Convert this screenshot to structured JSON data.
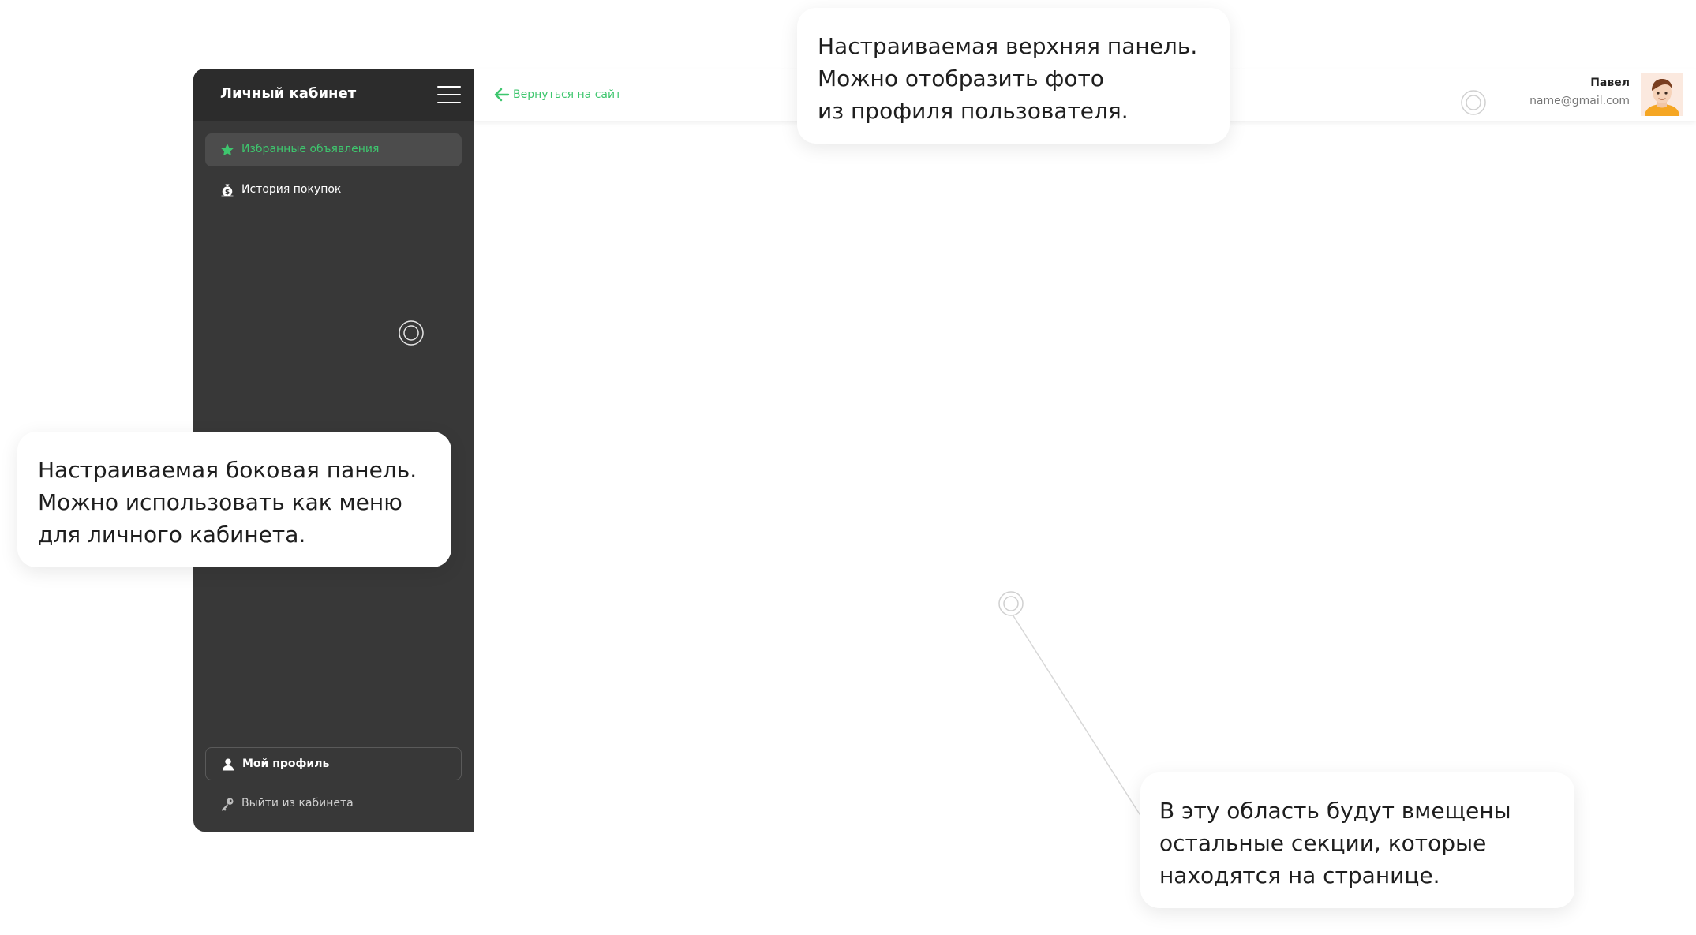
{
  "sidebar": {
    "title": "Личный кабинет",
    "items": [
      {
        "label": "Избранные объявления",
        "icon": "star-icon",
        "active": true
      },
      {
        "label": "История покупок",
        "icon": "money-bag-icon",
        "active": false
      }
    ],
    "bottom_items": [
      {
        "label": "Мой профиль",
        "icon": "user-icon"
      },
      {
        "label": "Выйти из кабинета",
        "icon": "key-icon"
      }
    ]
  },
  "topbar": {
    "back_label": "Вернуться на сайт",
    "user_name": "Павел",
    "user_email": "name@gmail.com"
  },
  "callouts": {
    "top": [
      "Настраиваемая верхняя панель.",
      "Можно отобразить фото",
      "из профиля пользователя."
    ],
    "side": [
      "Настраиваемая боковая панель.",
      "Можно использовать как меню",
      "для личного кабинета."
    ],
    "main": [
      "В эту область будут вмещены",
      "остальные секции, которые",
      "находятся на странице."
    ]
  },
  "colors": {
    "accent": "#3ec66e",
    "sidebar_bg": "#383838",
    "sidebar_header_bg": "#2c2c2c",
    "active_item_bg": "#4c4c4c"
  }
}
